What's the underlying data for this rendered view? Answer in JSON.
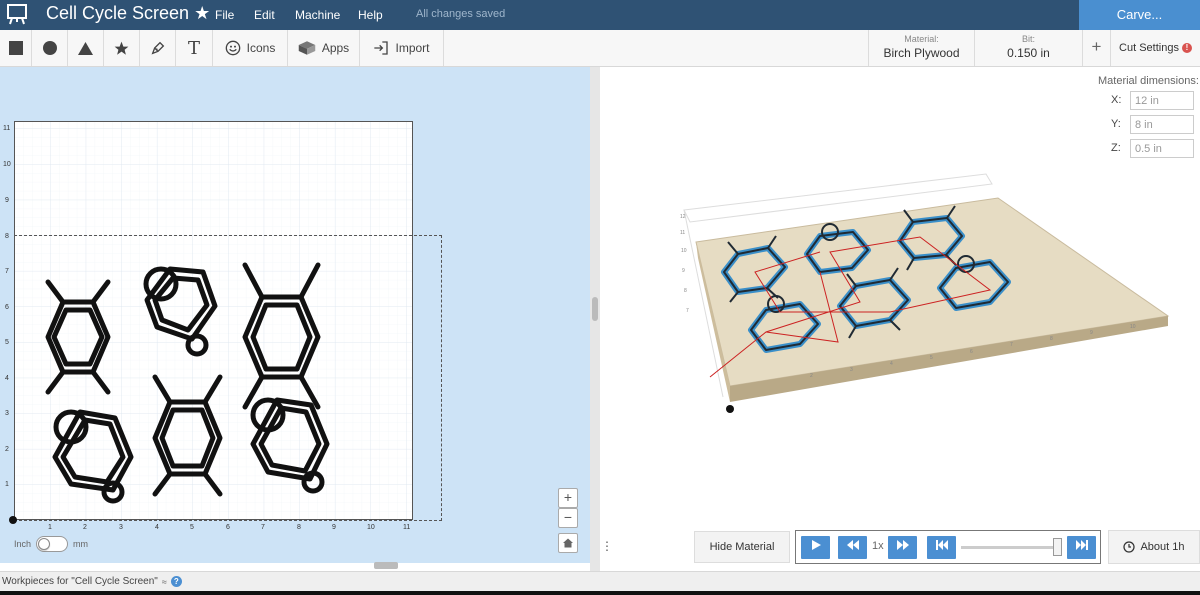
{
  "app": {
    "title": "Cell Cycle Screen",
    "star": "★",
    "save_status": "All changes saved"
  },
  "menu": [
    "File",
    "Edit",
    "Machine",
    "Help"
  ],
  "carve_label": "Carve...",
  "toolbar": {
    "shape_tools": [
      "square-icon",
      "circle-icon",
      "triangle-icon",
      "star-icon",
      "pen-icon",
      "text-tool-icon"
    ],
    "text_tool_glyph": "T",
    "icons_label": "Icons",
    "apps_label": "Apps",
    "import_label": "Import"
  },
  "material": {
    "caption": "Material:",
    "value": "Birch Plywood"
  },
  "bit": {
    "caption": "Bit:",
    "value": "0.150 in"
  },
  "plus_label": "+",
  "cut_settings": {
    "label": "Cut Settings",
    "warning": "!"
  },
  "design": {
    "y_ticks": [
      "11",
      "10",
      "9",
      "8",
      "7",
      "6",
      "5",
      "4",
      "3",
      "2",
      "1"
    ],
    "x_ticks": [
      "1",
      "2",
      "3",
      "4",
      "5",
      "6",
      "7",
      "8",
      "9",
      "10",
      "11"
    ],
    "unit_inch": "Inch",
    "unit_mm": "mm",
    "unit_selected": "Inch",
    "zoom_in": "+",
    "zoom_out": "−",
    "home_icon": "home-icon"
  },
  "material_dimensions": {
    "title": "Material dimensions:",
    "fields": [
      {
        "axis": "X:",
        "value": "12 in"
      },
      {
        "axis": "Y:",
        "value": "8 in"
      },
      {
        "axis": "Z:",
        "value": "0.5 in"
      }
    ]
  },
  "preview": {
    "hide_material": "Hide Material",
    "speed": "1x",
    "about_time": "About 1h",
    "sidebar_toggle": "⋮"
  },
  "workpieces": {
    "label": "Workpieces for \"Cell Cycle Screen\"",
    "chevron": "≈",
    "help": "?"
  },
  "colors": {
    "header": "#2f5274",
    "carve": "#4a8fd0",
    "canvas_bg": "#cde3f6",
    "player_btn": "#4b8fd2",
    "toolpath": "#3a8fc9",
    "plywood": "#e7dcc6"
  }
}
